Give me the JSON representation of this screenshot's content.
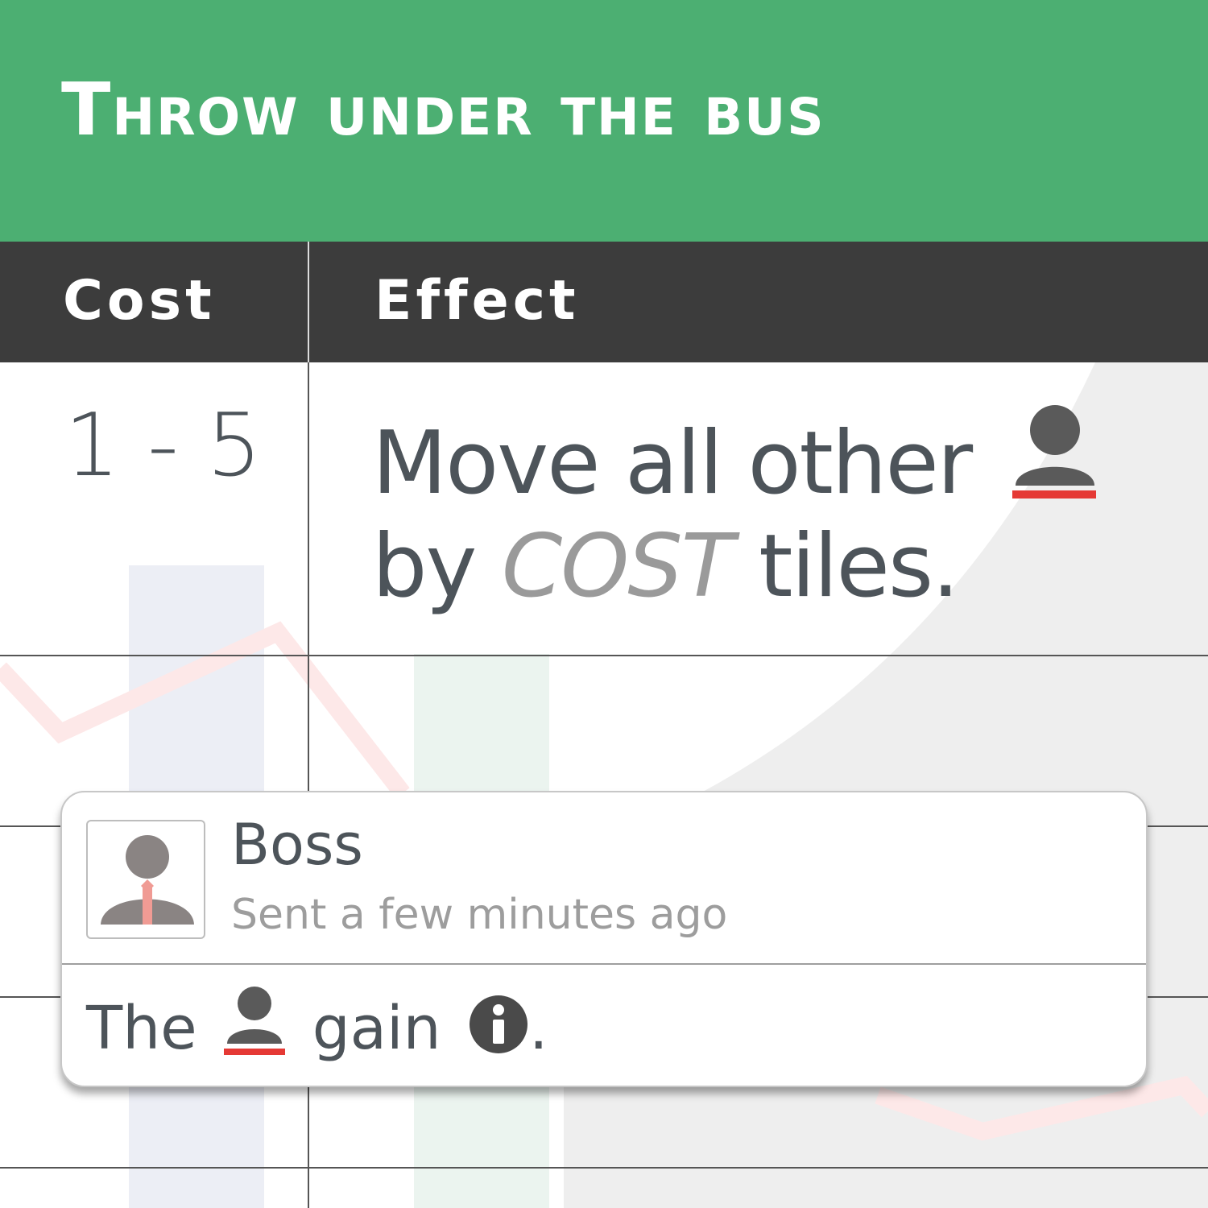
{
  "card_title": "Throw under the bus",
  "table": {
    "headers": {
      "cost": "Cost",
      "effect": "Effect"
    },
    "row": {
      "cost": "1 - 5",
      "effect": {
        "line1_text": "Move all other",
        "line1_icon": "player-icon",
        "line2_prefix": "by",
        "line2_keyword": "COST",
        "line2_suffix": "tiles."
      }
    }
  },
  "notification": {
    "sender": "Boss",
    "time": "Sent a few minutes ago",
    "avatar_icon": "boss-avatar-icon",
    "message": {
      "prefix": "The",
      "icon1": "player-icon",
      "middle": "gain",
      "icon2": "info-icon",
      "suffix": "."
    }
  },
  "colors": {
    "title_bar": "#4caf72",
    "header_bar": "#3c3c3c",
    "text": "#4d545a",
    "keyword": "#9a9a9a",
    "player_accent": "#e53935",
    "icon_dark": "#5a5a5a"
  }
}
